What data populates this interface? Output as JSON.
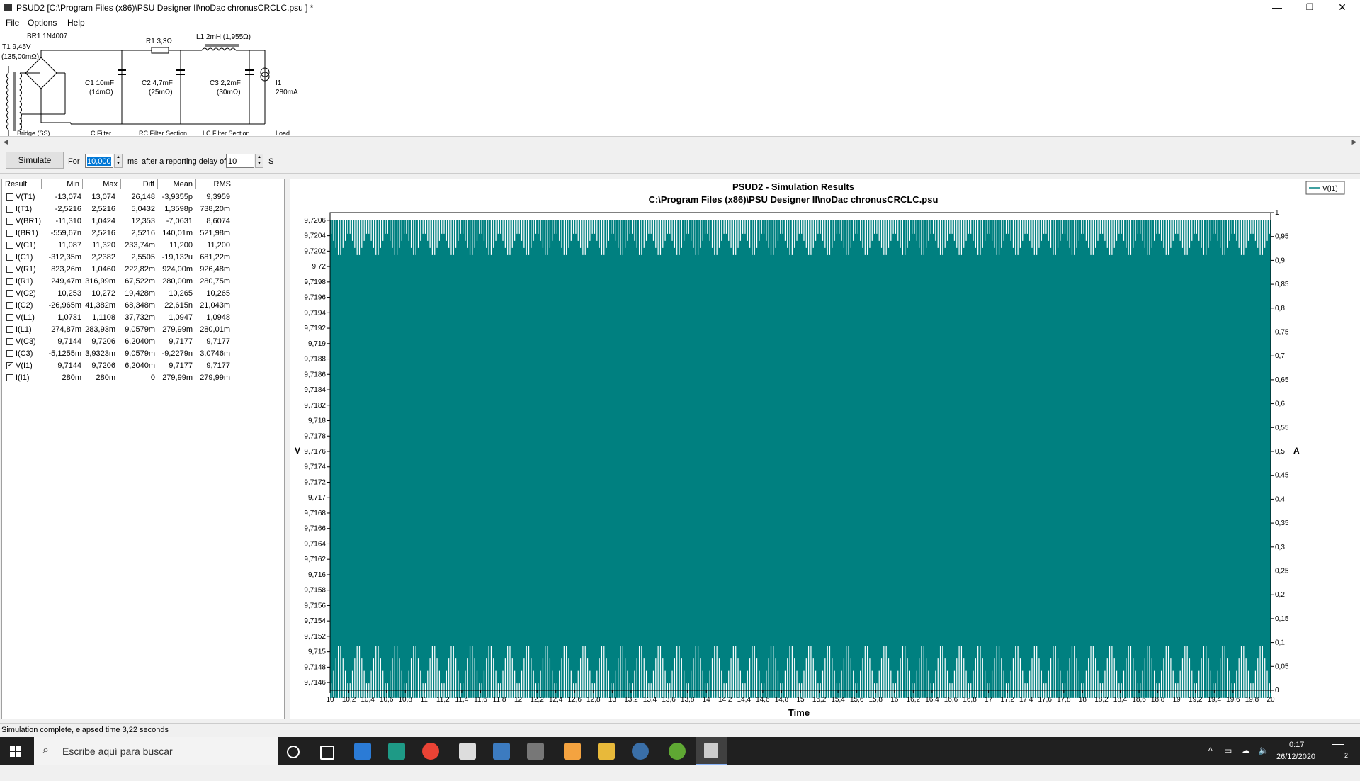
{
  "window": {
    "title": "PSUD2  [C:\\Program Files (x86)\\PSU Designer II\\noDac chronusCRCLC.psu ] *",
    "minimize": "—",
    "maximize": "❐",
    "close": "✕"
  },
  "menu": [
    "File",
    "Options",
    "Help"
  ],
  "schematic": {
    "br1": "BR1 1N4007",
    "t1": "T1 9,45V",
    "t1_res": "(135,00mΩ)",
    "r1": "R1 3,3Ω",
    "l1": "L1 2mH (1,955Ω)",
    "c1": "C1 10mF",
    "c1_esr": "(14mΩ)",
    "c2": "C2 4,7mF",
    "c2_esr": "(25mΩ)",
    "c3": "C3 2,2mF",
    "c3_esr": "(30mΩ)",
    "i1": "I1",
    "i1_val": "280mA",
    "sections": [
      "Bridge (SS)",
      "C Filter",
      "RC Filter Section",
      "LC Filter Section",
      "Load"
    ]
  },
  "controls": {
    "simulate": "Simulate",
    "for_label": "For",
    "duration": "10,000",
    "ms_label": "ms",
    "delay_label": "after a reporting delay of",
    "delay": "10",
    "s_label": "S"
  },
  "results": {
    "headers": [
      "Result",
      "Min",
      "Max",
      "Diff",
      "Mean",
      "RMS"
    ],
    "rows": [
      {
        "name": "V(T1)",
        "checked": false,
        "min": "-13,074",
        "max": "13,074",
        "diff": "26,148",
        "mean": "-3,9355p",
        "rms": "9,3959"
      },
      {
        "name": "I(T1)",
        "checked": false,
        "min": "-2,5216",
        "max": "2,5216",
        "diff": "5,0432",
        "mean": "1,3598p",
        "rms": "738,20m"
      },
      {
        "name": "V(BR1)",
        "checked": false,
        "min": "-11,310",
        "max": "1,0424",
        "diff": "12,353",
        "mean": "-7,0631",
        "rms": "8,6074"
      },
      {
        "name": "I(BR1)",
        "checked": false,
        "min": "-559,67n",
        "max": "2,5216",
        "diff": "2,5216",
        "mean": "140,01m",
        "rms": "521,98m"
      },
      {
        "name": "V(C1)",
        "checked": false,
        "min": "11,087",
        "max": "11,320",
        "diff": "233,74m",
        "mean": "11,200",
        "rms": "11,200"
      },
      {
        "name": "I(C1)",
        "checked": false,
        "min": "-312,35m",
        "max": "2,2382",
        "diff": "2,5505",
        "mean": "-19,132u",
        "rms": "681,22m"
      },
      {
        "name": "V(R1)",
        "checked": false,
        "min": "823,26m",
        "max": "1,0460",
        "diff": "222,82m",
        "mean": "924,00m",
        "rms": "926,48m"
      },
      {
        "name": "I(R1)",
        "checked": false,
        "min": "249,47m",
        "max": "316,99m",
        "diff": "67,522m",
        "mean": "280,00m",
        "rms": "280,75m"
      },
      {
        "name": "V(C2)",
        "checked": false,
        "min": "10,253",
        "max": "10,272",
        "diff": "19,428m",
        "mean": "10,265",
        "rms": "10,265"
      },
      {
        "name": "I(C2)",
        "checked": false,
        "min": "-26,965m",
        "max": "41,382m",
        "diff": "68,348m",
        "mean": "22,615n",
        "rms": "21,043m"
      },
      {
        "name": "V(L1)",
        "checked": false,
        "min": "1,0731",
        "max": "1,1108",
        "diff": "37,732m",
        "mean": "1,0947",
        "rms": "1,0948"
      },
      {
        "name": "I(L1)",
        "checked": false,
        "min": "274,87m",
        "max": "283,93m",
        "diff": "9,0579m",
        "mean": "279,99m",
        "rms": "280,01m"
      },
      {
        "name": "V(C3)",
        "checked": false,
        "min": "9,7144",
        "max": "9,7206",
        "diff": "6,2040m",
        "mean": "9,7177",
        "rms": "9,7177"
      },
      {
        "name": "I(C3)",
        "checked": false,
        "min": "-5,1255m",
        "max": "3,9323m",
        "diff": "9,0579m",
        "mean": "-9,2279n",
        "rms": "3,0746m"
      },
      {
        "name": "V(I1)",
        "checked": true,
        "min": "9,7144",
        "max": "9,7206",
        "diff": "6,2040m",
        "mean": "9,7177",
        "rms": "9,7177"
      },
      {
        "name": "I(I1)",
        "checked": false,
        "min": "280m",
        "max": "280m",
        "diff": "0",
        "mean": "279,99m",
        "rms": "279,99m"
      }
    ]
  },
  "chart_data": {
    "type": "line",
    "title": "PSUD2 - Simulation Results",
    "subtitle": "C:\\Program Files (x86)\\PSU Designer II\\noDac chronusCRCLC.psu",
    "xlabel": "Time",
    "ylabel": "V",
    "y2label": "A",
    "xlim": [
      10,
      20
    ],
    "ylim": [
      9.7145,
      9.7207
    ],
    "y2lim": [
      0,
      1
    ],
    "x_ticks": [
      "10",
      "10,2",
      "10,4",
      "10,6",
      "10,8",
      "11",
      "11,2",
      "11,4",
      "11,6",
      "11,8",
      "12",
      "12,2",
      "12,4",
      "12,6",
      "12,8",
      "13",
      "13,2",
      "13,4",
      "13,6",
      "13,8",
      "14",
      "14,2",
      "14,4",
      "14,6",
      "14,8",
      "15",
      "15,2",
      "15,4",
      "15,6",
      "15,8",
      "16",
      "16,2",
      "16,4",
      "16,6",
      "16,8",
      "17",
      "17,2",
      "17,4",
      "17,6",
      "17,8",
      "18",
      "18,2",
      "18,4",
      "18,6",
      "18,8",
      "19",
      "19,2",
      "19,4",
      "19,6",
      "19,8",
      "20"
    ],
    "y_ticks": [
      "9,7206",
      "9,7204",
      "9,7202",
      "9,72",
      "9,7198",
      "9,7196",
      "9,7194",
      "9,7192",
      "9,719",
      "9,7188",
      "9,7186",
      "9,7184",
      "9,7182",
      "9,718",
      "9,7178",
      "9,7176",
      "9,7174",
      "9,7172",
      "9,717",
      "9,7168",
      "9,7166",
      "9,7164",
      "9,7162",
      "9,716",
      "9,7158",
      "9,7156",
      "9,7154",
      "9,7152",
      "9,715",
      "9,7148",
      "9,7146"
    ],
    "y2_ticks": [
      "1",
      "0,95",
      "0,9",
      "0,85",
      "0,8",
      "0,75",
      "0,7",
      "0,65",
      "0,6",
      "0,55",
      "0,5",
      "0,45",
      "0,4",
      "0,35",
      "0,3",
      "0,25",
      "0,2",
      "0,15",
      "0,1",
      "0,05",
      "0"
    ],
    "series": [
      {
        "name": "V(I1)",
        "color": "#008080",
        "min": 9.7144,
        "max": 9.7206,
        "ripple_periods": 50
      }
    ],
    "legend_position": "top-right",
    "grid": false
  },
  "status": "Simulation complete, elapsed time 3,22 seconds",
  "taskbar": {
    "search_placeholder": "Escribe aquí para buscar",
    "time": "0:17",
    "date": "26/12/2020",
    "notifications": "2"
  }
}
